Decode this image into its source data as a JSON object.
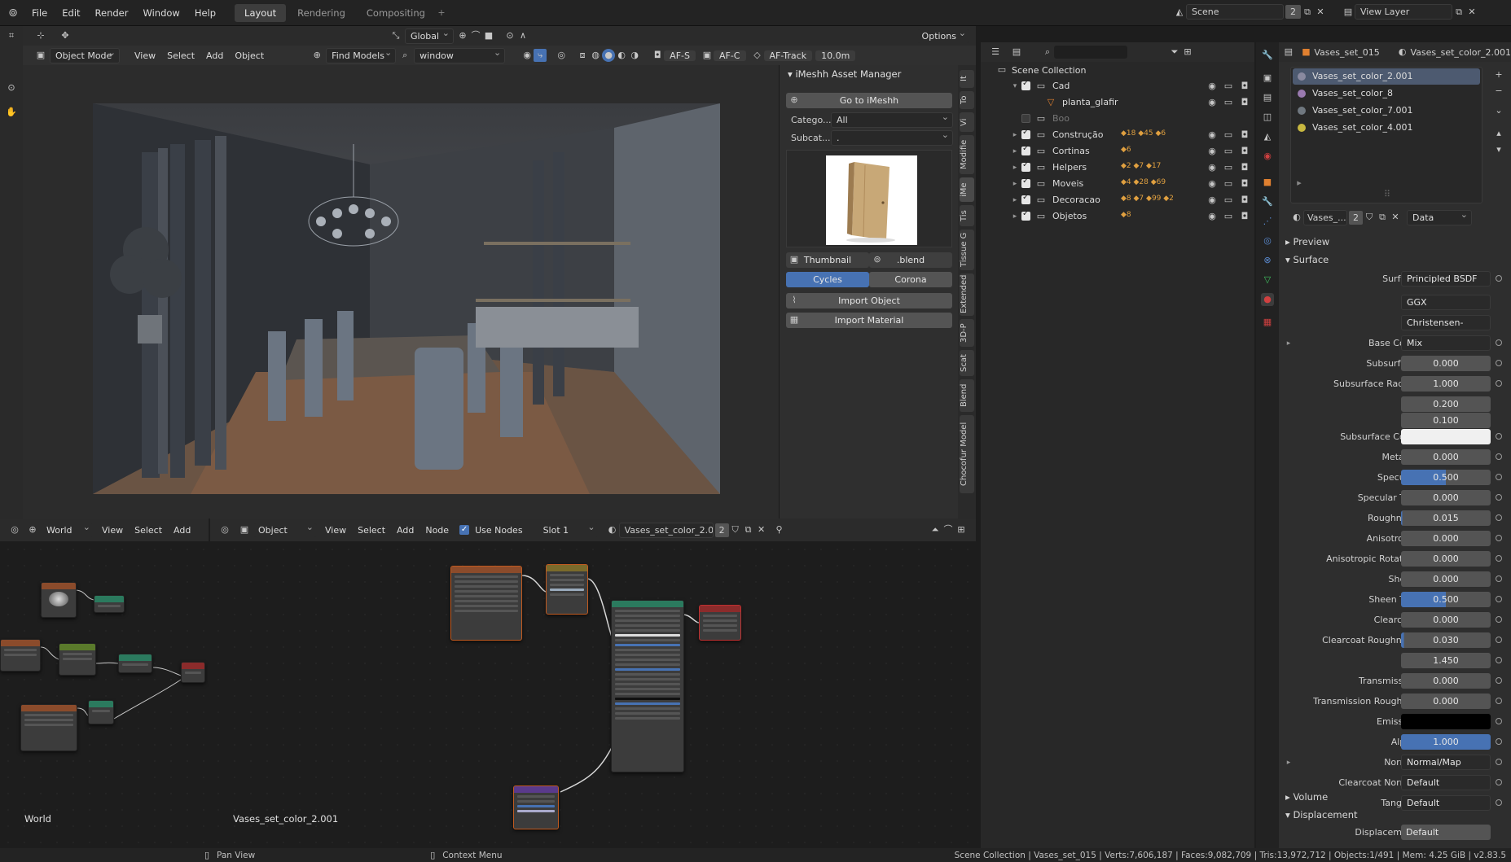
{
  "menu": [
    "File",
    "Edit",
    "Render",
    "Window",
    "Help"
  ],
  "workspaces": {
    "layout": "Layout",
    "rendering": "Rendering",
    "compositing": "Compositing"
  },
  "top_right": {
    "scene_label": "Scene",
    "scene_users": "2",
    "view_layer": "View Layer"
  },
  "viewport_header": {
    "transform": "Global",
    "options": "Options"
  },
  "viewport_header2": {
    "mode": "Object Mode",
    "view": "View",
    "select": "Select",
    "add": "Add",
    "object": "Object",
    "find_models": "Find Models",
    "search_value": "window",
    "af_s": "AF-S",
    "af_c": "AF-C",
    "af_track": "AF-Track",
    "distance": "10.0m"
  },
  "asset_manager": {
    "title": "iMeshh Asset Manager",
    "goto": "Go to iMeshh",
    "category_label": "Catego...",
    "category_value": "All",
    "subcategory_label": "Subcat...",
    "subcategory_value": ".",
    "thumbnail": "Thumbnail",
    "blend": ".blend",
    "cycles": "Cycles",
    "corona": "Corona",
    "import_object": "Import Object",
    "import_material": "Import Material"
  },
  "side_tabs": [
    "It",
    "To",
    "Vi",
    "Modifie",
    "iMe",
    "Tis",
    "Tissue G",
    "Extended",
    "3D-P",
    "Scat",
    "Blend",
    "Chocofur Model"
  ],
  "outliner": {
    "title": "Scene Collection",
    "items": [
      {
        "name": "Cad",
        "level": 1
      },
      {
        "name": "planta_glafir",
        "level": 2
      },
      {
        "name": "Boo",
        "level": 1
      },
      {
        "name": "Construção",
        "level": 1,
        "c1": "18",
        "c2": "45",
        "c3": "6"
      },
      {
        "name": "Cortinas",
        "level": 1,
        "c1": "6"
      },
      {
        "name": "Helpers",
        "level": 1,
        "c1": "2",
        "c2": "7",
        "c3": "17"
      },
      {
        "name": "Moveis",
        "level": 1,
        "c1": "4",
        "c2": "28",
        "c3": "69"
      },
      {
        "name": "Decoracao",
        "level": 1,
        "c1": "8",
        "c2": "7",
        "c3": "99",
        "c4": "2"
      },
      {
        "name": "Objetos",
        "level": 1,
        "c1": "8"
      }
    ]
  },
  "props_header": {
    "object": "Vases_set_015",
    "material": "Vases_set_color_2.001"
  },
  "materials": [
    "Vases_set_color_2.001",
    "Vases_set_color_8",
    "Vases_set_color_7.001",
    "Vases_set_color_4.001"
  ],
  "material_slot": {
    "name": "Vases_...",
    "users": "2",
    "link": "Data"
  },
  "surface": {
    "preview": "Preview",
    "surface_section": "Surface",
    "rows": [
      {
        "label": "Surface",
        "value": "Principled BSDF",
        "type": "dd"
      },
      {
        "label": "",
        "value": "GGX",
        "type": "dd"
      },
      {
        "label": "",
        "value": "Christensen-Burley",
        "type": "dd"
      },
      {
        "label": "Base Color",
        "value": "Mix",
        "type": "dd"
      },
      {
        "label": "Subsurface",
        "value": "0.000",
        "type": "num",
        "fill": 0
      },
      {
        "label": "Subsurface Radius",
        "value": "1.000",
        "type": "num",
        "fill": 0
      },
      {
        "label": "",
        "value": "0.200",
        "type": "num",
        "fill": 0
      },
      {
        "label": "",
        "value": "0.100",
        "type": "num",
        "fill": 0
      },
      {
        "label": "Subsurface Color",
        "value": "",
        "type": "white"
      },
      {
        "label": "Metallic",
        "value": "0.000",
        "type": "num",
        "fill": 0
      },
      {
        "label": "Specular",
        "value": "0.500",
        "type": "num",
        "fill": 50
      },
      {
        "label": "Specular Tint",
        "value": "0.000",
        "type": "num",
        "fill": 0
      },
      {
        "label": "Roughness",
        "value": "0.015",
        "type": "num",
        "fill": 1.5
      },
      {
        "label": "Anisotropic",
        "value": "0.000",
        "type": "num",
        "fill": 0
      },
      {
        "label": "Anisotropic Rotation",
        "value": "0.000",
        "type": "num",
        "fill": 0
      },
      {
        "label": "Sheen",
        "value": "0.000",
        "type": "num",
        "fill": 0
      },
      {
        "label": "Sheen Tint",
        "value": "0.500",
        "type": "num",
        "fill": 50
      },
      {
        "label": "Clearcoat",
        "value": "0.000",
        "type": "num",
        "fill": 0
      },
      {
        "label": "Clearcoat Roughness",
        "value": "0.030",
        "type": "num",
        "fill": 3
      },
      {
        "label": "IOR",
        "value": "1.450",
        "type": "num",
        "fill": 0
      },
      {
        "label": "Transmission",
        "value": "0.000",
        "type": "num",
        "fill": 0
      },
      {
        "label": "Transmission Roughn...",
        "value": "0.000",
        "type": "num",
        "fill": 0
      },
      {
        "label": "Emission",
        "value": "",
        "type": "black"
      },
      {
        "label": "Alpha",
        "value": "1.000",
        "type": "num",
        "fill": 100
      },
      {
        "label": "Normal",
        "value": "Normal/Map",
        "type": "dd"
      },
      {
        "label": "Clearcoat Normal",
        "value": "Default",
        "type": "dd"
      },
      {
        "label": "Tangent",
        "value": "Default",
        "type": "dd"
      }
    ],
    "volume": "Volume",
    "displacement": "Displacement",
    "displacement_row": "Displacement",
    "displacement_value": "Default"
  },
  "node_header_left": {
    "type": "World",
    "view": "View",
    "select": "Select",
    "add": "Add"
  },
  "node_header": {
    "object": "Object",
    "view": "View",
    "select": "Select",
    "add": "Add",
    "node": "Node",
    "use_nodes": "Use Nodes",
    "slot": "Slot 1",
    "material": "Vases_set_color_2.0...",
    "users": "2"
  },
  "world_label": "World",
  "material_label": "Vases_set_color_2.001",
  "status": {
    "left1": "Pan View",
    "left2": "Context Menu",
    "right": "Scene Collection | Vases_set_015 | Verts:7,606,187 | Faces:9,082,709 | Tris:13,972,712 | Objects:1/491 | Mem: 4.25 GiB | v2.83.5"
  },
  "colors": {
    "accent": "#4772b3",
    "panel": "#2e2e2e",
    "header": "#2b2b2b"
  }
}
